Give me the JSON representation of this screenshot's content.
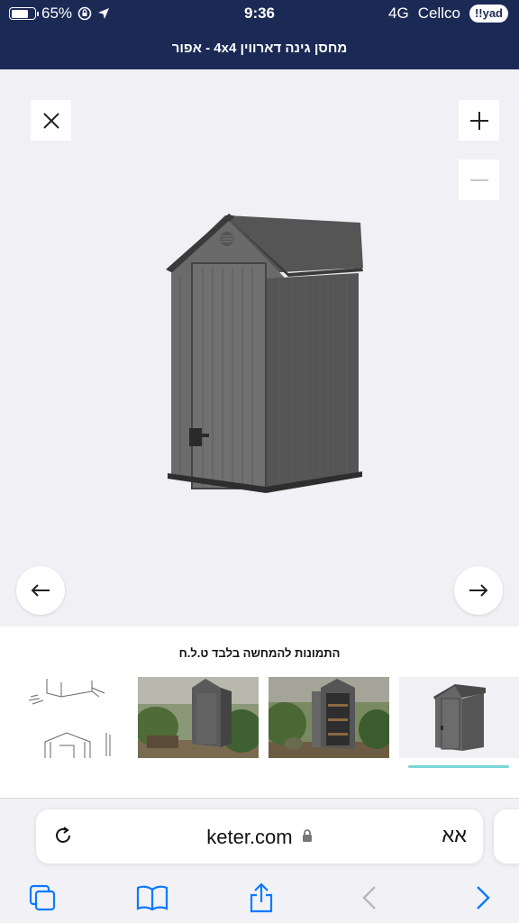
{
  "status_bar": {
    "battery": "65%",
    "battery_level": 0.65,
    "time": "9:36",
    "network": "4G",
    "carrier": "Cellco",
    "badge": "!!yad"
  },
  "header": {
    "title": "מחסן גינה דארווין 4x4 - אפור"
  },
  "gallery": {
    "close_icon": "close-icon",
    "zoom_in_icon": "plus-icon",
    "zoom_out_icon": "minus-icon",
    "prev_icon": "arrow-left-icon",
    "next_icon": "arrow-right-icon",
    "caption": "התמונות להמחשה בלבד ט.ל.ח",
    "thumbnails": [
      {
        "name": "diagram"
      },
      {
        "name": "garden-closed"
      },
      {
        "name": "garden-open"
      },
      {
        "name": "product",
        "selected": true
      }
    ]
  },
  "browser": {
    "domain": "keter.com",
    "aa_label": "אא",
    "accent": "#0a7aff"
  }
}
